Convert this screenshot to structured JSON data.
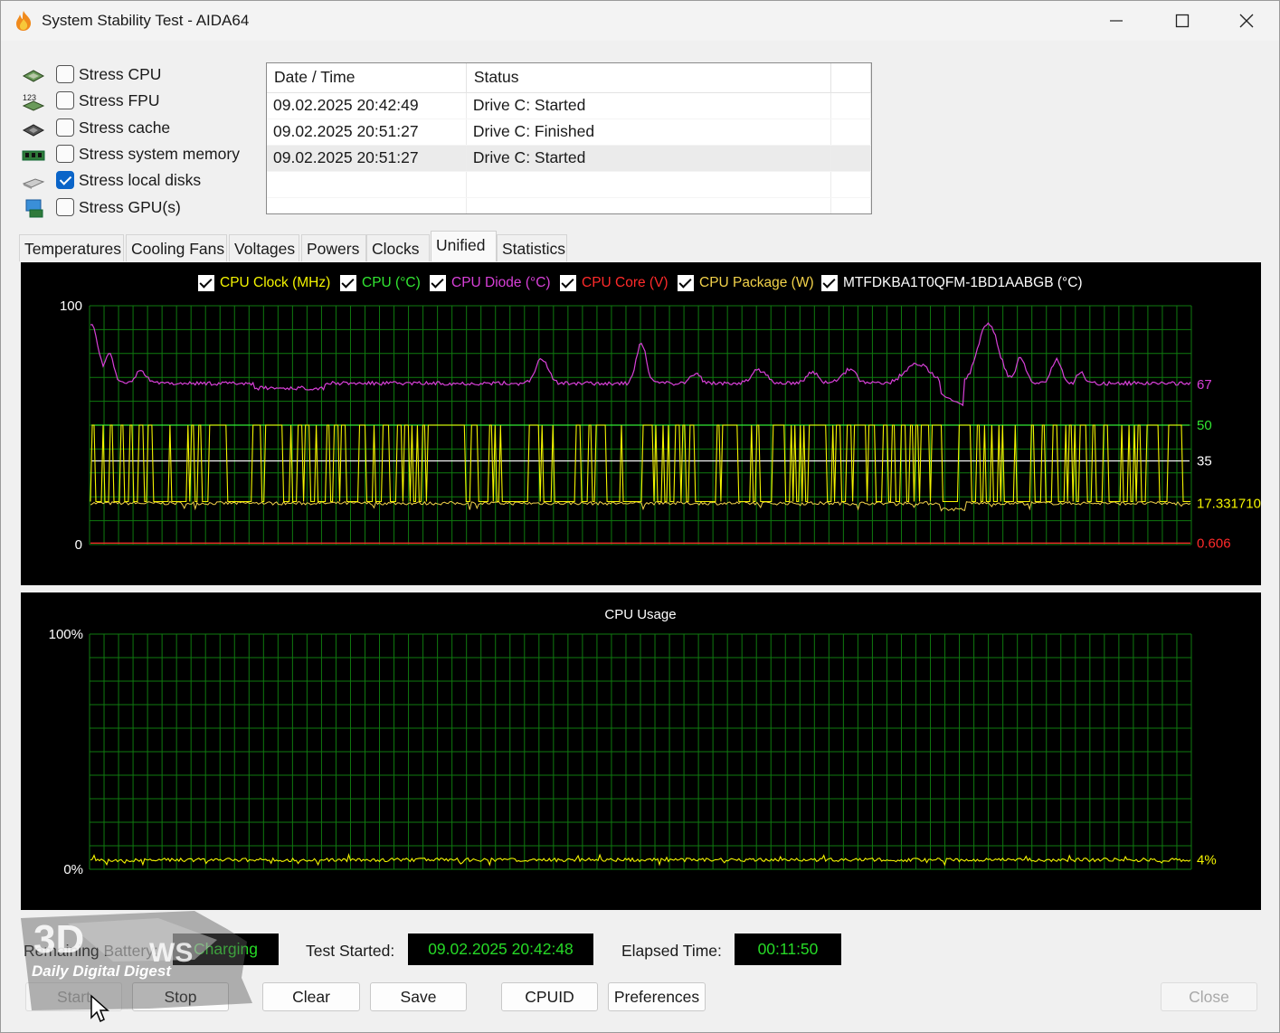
{
  "window": {
    "title": "System Stability Test - AIDA64"
  },
  "options": [
    {
      "label": "Stress CPU",
      "checked": false,
      "icon": "cpu-chip-icon"
    },
    {
      "label": "Stress FPU",
      "checked": false,
      "icon": "fpu-123-icon"
    },
    {
      "label": "Stress cache",
      "checked": false,
      "icon": "cache-chip-icon"
    },
    {
      "label": "Stress system memory",
      "checked": false,
      "icon": "memory-module-icon"
    },
    {
      "label": "Stress local disks",
      "checked": true,
      "icon": "disk-drive-icon"
    },
    {
      "label": "Stress GPU(s)",
      "checked": false,
      "icon": "gpu-monitor-icon"
    }
  ],
  "log": {
    "headers": [
      "Date / Time",
      "Status"
    ],
    "rows": [
      {
        "datetime": "09.02.2025 20:42:49",
        "status": "Drive C: Started"
      },
      {
        "datetime": "09.02.2025 20:51:27",
        "status": "Drive C: Finished"
      },
      {
        "datetime": "09.02.2025 20:51:27",
        "status": "Drive C: Started"
      }
    ]
  },
  "tabs": [
    "Temperatures",
    "Cooling Fans",
    "Voltages",
    "Powers",
    "Clocks",
    "Unified",
    "Statistics"
  ],
  "active_tab": "Unified",
  "colors": {
    "grid": "#0f7a0f",
    "clock": "#f4f400",
    "cpu_temp": "#32e632",
    "cpu_diode": "#d840d8",
    "cpu_core": "#ff2a2a",
    "cpu_package": "#f2d24a",
    "disk_temp": "#ffffff",
    "status_green": "#26d926"
  },
  "chart_data": [
    {
      "type": "line",
      "ylim": [
        0,
        100
      ],
      "ytick_labels": [
        "100",
        "0"
      ],
      "series": [
        {
          "name": "CPU Clock (MHz)",
          "color": "#f4f400",
          "current": "",
          "approx_range": [
            17,
            50
          ]
        },
        {
          "name": "CPU (°C)",
          "color": "#32e632",
          "current": "50",
          "approx_range": [
            50,
            50
          ]
        },
        {
          "name": "CPU Diode (°C)",
          "color": "#d840d8",
          "current": "67",
          "approx_range": [
            59,
            95
          ]
        },
        {
          "name": "CPU Core (V)",
          "color": "#ff2a2a",
          "current": "0.606",
          "approx_range": [
            0.6,
            0.6
          ]
        },
        {
          "name": "CPU Package (W)",
          "color": "#f2d24a",
          "current": "17.331710",
          "approx_range": [
            13,
            19
          ]
        },
        {
          "name": "MTFDKBA1T0QFM-1BD1AABGB (°C)",
          "color": "#ffffff",
          "current": "35",
          "approx_range": [
            35,
            35
          ]
        }
      ],
      "right_labels": [
        "67",
        "50",
        "35",
        "17.331710",
        "0.606"
      ]
    },
    {
      "type": "line",
      "title": "CPU Usage",
      "ylim": [
        0,
        100
      ],
      "ytick_labels": [
        "100%",
        "0%"
      ],
      "series": [
        {
          "color": "#f4f400",
          "current": "4%",
          "approx_range": [
            2,
            6
          ]
        }
      ]
    }
  ],
  "status": {
    "battery_label": "Remaining Battery:",
    "battery_value": "Charging",
    "test_started_label": "Test Started:",
    "test_started_value": "09.02.2025 20:42:48",
    "elapsed_label": "Elapsed Time:",
    "elapsed_value": "00:11:50"
  },
  "buttons": {
    "start": "Start",
    "stop": "Stop",
    "clear": "Clear",
    "save": "Save",
    "cpuid": "CPUID",
    "preferences": "Preferences",
    "close": "Close"
  },
  "watermark": {
    "logo": "3DNews",
    "tagline": "Daily Digital Digest"
  }
}
